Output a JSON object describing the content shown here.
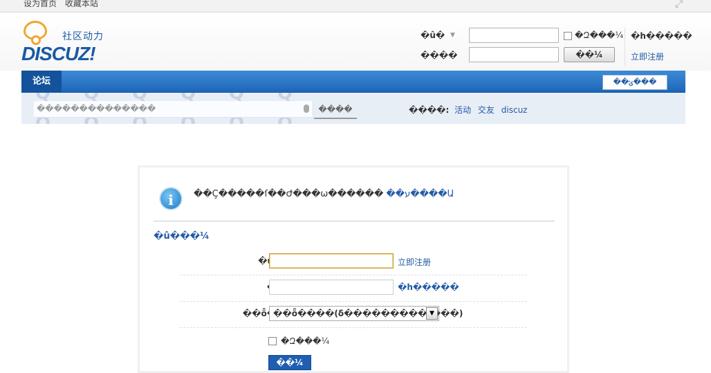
{
  "topbar": {
    "set_home": "设为首页",
    "bookmark": "收藏本站",
    "expand_icon": "expand-icon"
  },
  "logo": {
    "cn": "社区动力",
    "en": "DISCUZ!"
  },
  "mini_login": {
    "username_label": "�û�",
    "password_label": "����",
    "remember_label": "�Զ���¼",
    "login_button": "��¼",
    "forgot_link": "�һ�����",
    "register_link": "立即注册"
  },
  "nav": {
    "forum_tab": "论坛",
    "quick_nav": "��ݵ���"
  },
  "search": {
    "placeholder": "��������������",
    "type": "����",
    "hot_label": "����:",
    "hot_items": [
      "活动",
      "交友",
      "discuz"
    ]
  },
  "panel": {
    "message": "��Ҫ�����ſ��Ժ���ѡ������",
    "message_link": "��ע����Ա",
    "section_title": "�û���¼",
    "rows": {
      "username_label": "�û���",
      "register_link": "立即注册",
      "password_label": "����:",
      "forgot_link": "�һ�����",
      "question_label": "��ȫ����:",
      "question_value": "��ȫ����(δ���������ɺ���)"
    },
    "remember_label": "�Զ���¼",
    "submit_label": "��¼"
  },
  "colors": {
    "brand_blue": "#1a5aa6",
    "nav_blue": "#1e66b8",
    "link_blue": "#225aa6",
    "logo_orange": "#f0a72e"
  }
}
